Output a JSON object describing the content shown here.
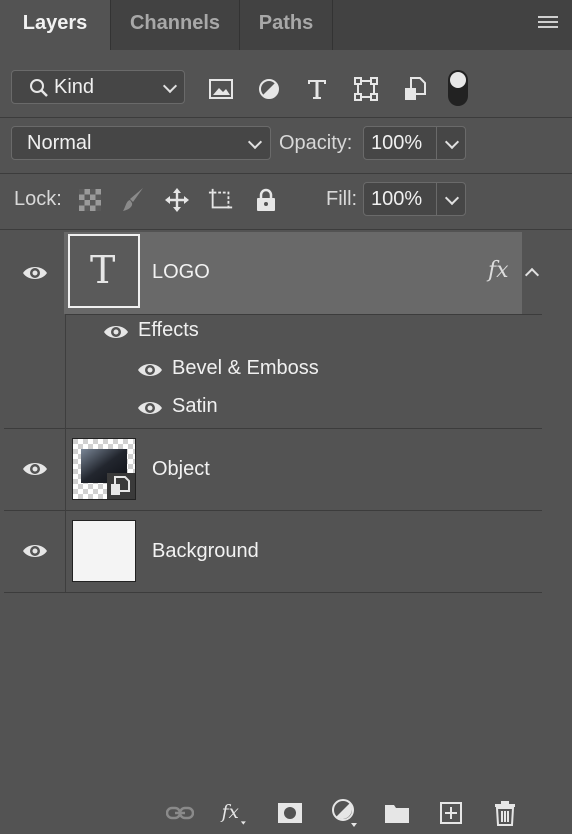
{
  "tabs": [
    {
      "label": "Layers",
      "active": true
    },
    {
      "label": "Channels",
      "active": false
    },
    {
      "label": "Paths",
      "active": false
    }
  ],
  "filter": {
    "kind_label": "Kind",
    "icons": [
      "image-filter-icon",
      "adjustment-filter-icon",
      "type-filter-icon",
      "shape-filter-icon",
      "smart-object-filter-icon"
    ]
  },
  "blend": {
    "mode": "Normal",
    "opacity_label": "Opacity:",
    "opacity_value": "100%"
  },
  "lock": {
    "label": "Lock:",
    "fill_label": "Fill:",
    "fill_value": "100%"
  },
  "layers": [
    {
      "name": "LOGO",
      "type": "text",
      "selected": true,
      "fx": "fx"
    },
    {
      "name": "Object",
      "type": "smart-object",
      "selected": false
    },
    {
      "name": "Background",
      "type": "raster",
      "selected": false
    }
  ],
  "effects": {
    "header": "Effects",
    "items": [
      "Bevel & Emboss",
      "Satin"
    ]
  },
  "text_thumb_glyph": "T",
  "colors": {
    "panel": "#535353",
    "tabbar": "#424242",
    "selected_row": "#696969"
  }
}
